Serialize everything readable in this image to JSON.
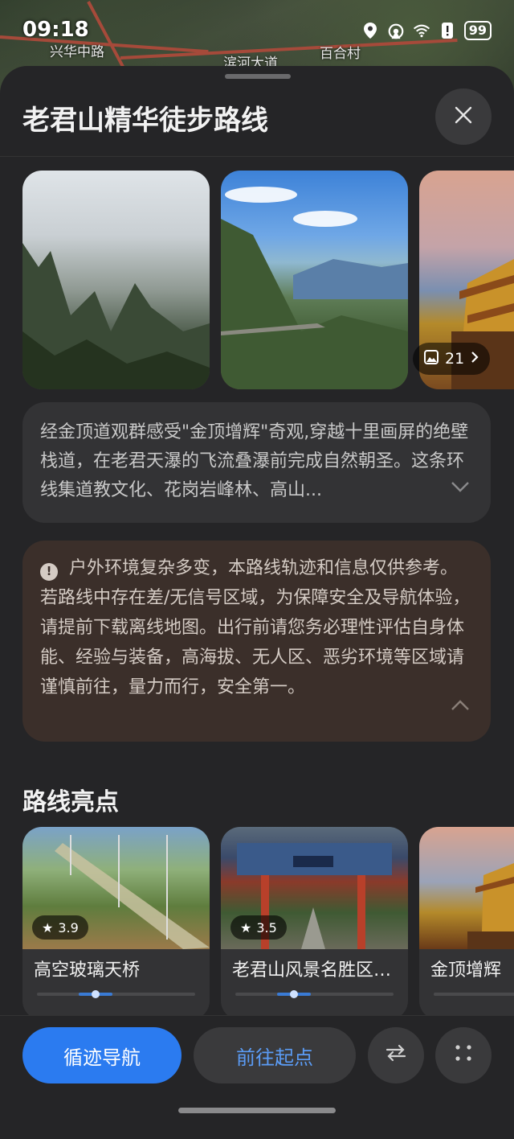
{
  "status_bar": {
    "time": "09:18",
    "battery": "99",
    "icons": [
      "location-icon",
      "hotspot-icon",
      "wifi-icon",
      "alert-icon",
      "battery-icon"
    ]
  },
  "map": {
    "labels": [
      "兴华中路",
      "滨河大道",
      "百合村"
    ]
  },
  "sheet": {
    "title": "老君山精华徒步路线",
    "photo_count": "21",
    "description": "经金顶道观群感受\"金顶增辉\"奇观,穿越十里画屏的绝壁栈道，在老君天瀑的飞流叠瀑前完成自然朝圣。这条环线集道教文化、花岗岩峰林、高山...",
    "warning": "户外环境复杂多变，本路线轨迹和信息仅供参考。若路线中存在差/无信号区域，为保障安全及导航体验，请提前下载离线地图。出行前请您务必理性评估自身体能、经验与装备，高海拔、无人区、恶劣环境等区域请谨慎前往，量力而行，安全第一。",
    "highlights_title": "路线亮点",
    "highlights": [
      {
        "name": "高空玻璃天桥",
        "rating": "3.9",
        "progress": 0.37
      },
      {
        "name": "老君山风景名胜区-中天门",
        "rating": "3.5",
        "progress": 0.37
      },
      {
        "name": "金顶增辉",
        "rating": "",
        "progress": 0.75
      }
    ]
  },
  "bottom_bar": {
    "primary_label": "循迹导航",
    "secondary_label": "前往起点"
  },
  "colors": {
    "accent": "#2b7bf0",
    "accent_text": "#5b9cf6",
    "sheet_bg": "#252527",
    "warning_bg": "#3b2f2a"
  }
}
